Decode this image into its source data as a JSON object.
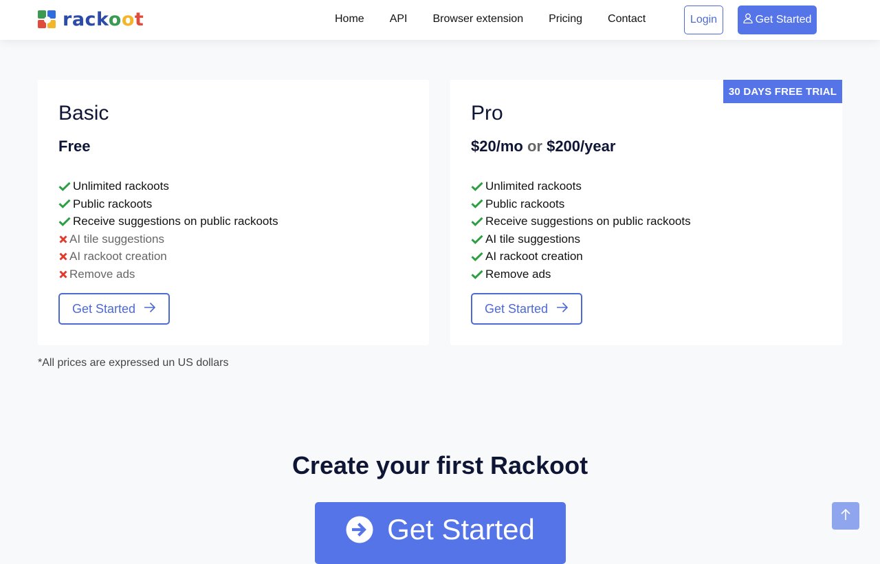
{
  "brand": {
    "name": "rackoot"
  },
  "nav": {
    "links": [
      "Home",
      "API",
      "Browser extension",
      "Pricing",
      "Contact"
    ],
    "login_label": "Login",
    "get_started_label": "Get Started"
  },
  "plans": [
    {
      "name": "Basic",
      "price": "Free",
      "features": [
        {
          "text": "Unlimited rackoots",
          "included": true
        },
        {
          "text": "Public rackoots",
          "included": true
        },
        {
          "text": "Receive suggestions on public rackoots",
          "included": true
        },
        {
          "text": "AI tile suggestions",
          "included": false
        },
        {
          "text": "AI rackoot creation",
          "included": false
        },
        {
          "text": "Remove ads",
          "included": false
        }
      ],
      "button_label": "Get Started"
    },
    {
      "name": "Pro",
      "price_monthly": "$20/mo",
      "price_or": "or",
      "price_yearly": "$200/year",
      "badge": "30 DAYS FREE TRIAL",
      "features": [
        {
          "text": "Unlimited rackoots",
          "included": true
        },
        {
          "text": "Public rackoots",
          "included": true
        },
        {
          "text": "Receive suggestions on public rackoots",
          "included": true
        },
        {
          "text": "AI tile suggestions",
          "included": true
        },
        {
          "text": "AI rackoot creation",
          "included": true
        },
        {
          "text": "Remove ads",
          "included": true
        }
      ],
      "button_label": "Get Started"
    }
  ],
  "note": "*All prices are expressed un US dollars",
  "cta": {
    "heading": "Create your first Rackoot",
    "button_label": "Get Started"
  },
  "colors": {
    "accent": "#5474e8",
    "check": "#2e9e45",
    "cross": "#e03a2f",
    "heading": "#0f1535"
  },
  "icons": {
    "included": "check-icon",
    "excluded": "cross-icon",
    "button_arrow": "arrow-right-icon",
    "user": "user-icon",
    "cta": "arrow-circle-right-icon",
    "scroll_top": "arrow-up-icon"
  }
}
